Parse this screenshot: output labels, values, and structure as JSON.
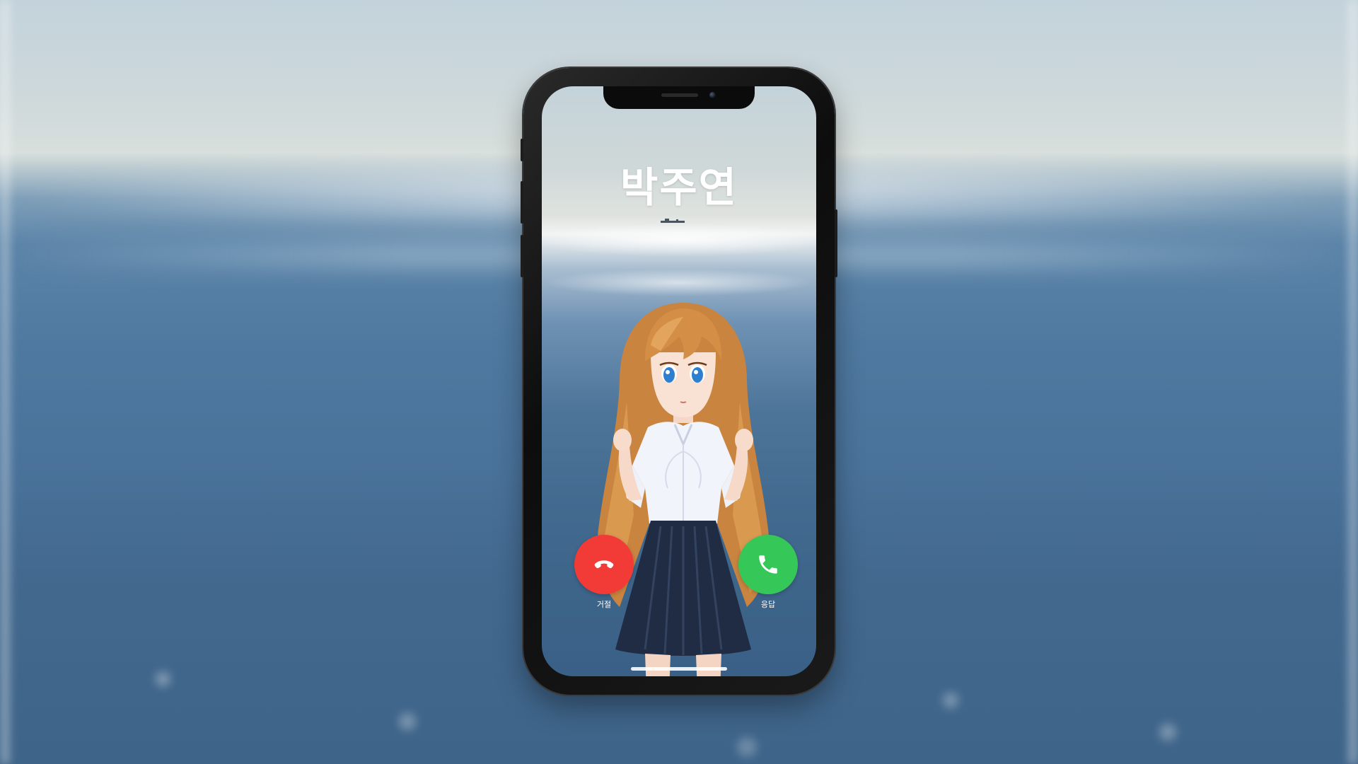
{
  "call": {
    "caller_name": "박주연",
    "decline_label": "거절",
    "accept_label": "응답",
    "decline_icon": "phone-hangup-icon",
    "accept_icon": "phone-icon"
  },
  "colors": {
    "decline": "#f23b36",
    "accept": "#36c759",
    "phone_frame": "#111111"
  }
}
